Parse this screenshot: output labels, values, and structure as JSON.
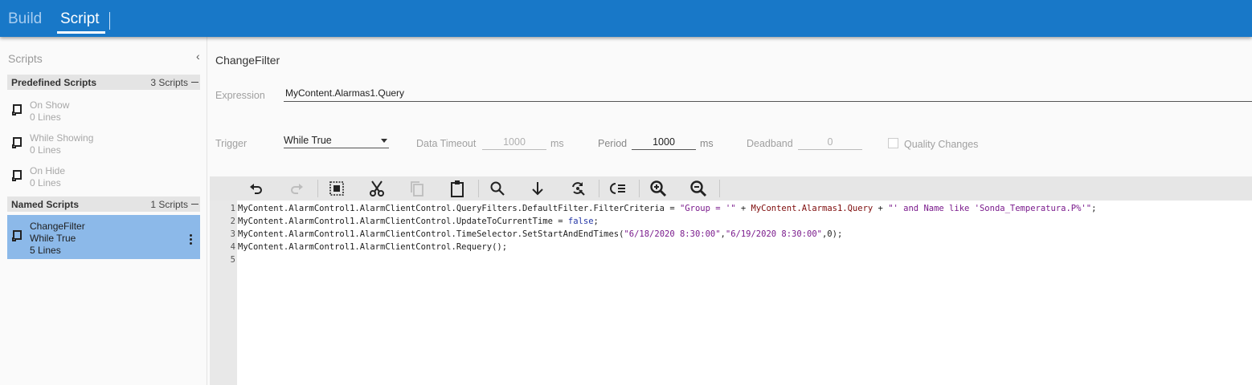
{
  "header": {
    "tabs": [
      {
        "label": "Build"
      },
      {
        "label": "Script"
      }
    ],
    "active_tab": "Script",
    "colors": {
      "bar": "#1878c8",
      "active_text": "#ffffff",
      "inactive_text": "#a8cdf0"
    }
  },
  "sidebar": {
    "title": "Scripts",
    "collapse_icon": "chevron-left-icon",
    "groups": [
      {
        "name": "Predefined Scripts",
        "count": "3 Scripts",
        "items": [
          {
            "name": "On Show",
            "lines": "0 Lines"
          },
          {
            "name": "While Showing",
            "lines": "0 Lines"
          },
          {
            "name": "On Hide",
            "lines": "0 Lines"
          }
        ]
      },
      {
        "name": "Named Scripts",
        "count": "1 Scripts",
        "items": [
          {
            "name": "ChangeFilter",
            "trigger": "While True",
            "lines": "5 Lines",
            "selected": true
          }
        ]
      }
    ],
    "selected_color": "#8cb9e9"
  },
  "main": {
    "title": "ChangeFilter",
    "expression": {
      "label": "Expression",
      "value": "MyContent.Alarmas1.Query"
    },
    "trigger": {
      "label": "Trigger",
      "value": "While True"
    },
    "data_timeout": {
      "label": "Data Timeout",
      "value": "1000",
      "unit": "ms"
    },
    "period": {
      "label": "Period",
      "value": "1000",
      "unit": "ms"
    },
    "deadband": {
      "label": "Deadband",
      "value": "0"
    },
    "quality_changes": {
      "label": "Quality Changes",
      "checked": false
    }
  },
  "toolbar": {
    "buttons": [
      {
        "icon": "undo-icon"
      },
      {
        "icon": "redo-icon",
        "disabled": true
      },
      {
        "icon": "select-all-icon"
      },
      {
        "icon": "cut-icon"
      },
      {
        "icon": "copy-icon",
        "disabled": true
      },
      {
        "icon": "paste-icon"
      },
      {
        "icon": "search-icon"
      },
      {
        "icon": "find-next-icon"
      },
      {
        "icon": "replace-icon"
      },
      {
        "icon": "outdent-icon"
      },
      {
        "icon": "zoom-in-icon"
      },
      {
        "icon": "zoom-out-icon"
      }
    ]
  },
  "editor": {
    "line_numbers": [
      "1",
      "2",
      "3",
      "4",
      "5"
    ],
    "lines": [
      {
        "l1_a": "MyContent.AlarmControl1.AlarmClientControl.QueryFilters.DefaultFilter.FilterCriteria = ",
        "l1_b": "\"Group = '\"",
        "l1_c": " + ",
        "l1_d": "MyContent.Alarmas1.Query",
        "l1_e": " + ",
        "l1_f": "\"' and Name like 'Sonda_Temperatura.P%'\"",
        "l1_g": ";"
      }
    ],
    "line2_a": "MyContent.AlarmControl1.AlarmClientControl.UpdateToCurrentTime = ",
    "line2_b": "false",
    "line2_c": ";",
    "line3_a": "MyContent.AlarmControl1.AlarmClientControl.TimeSelector.SetStartAndEndTimes(",
    "line3_b": "\"6/18/2020 8:30:00\"",
    "line3_c": ",",
    "line3_d": "\"6/19/2020 8:30:00\"",
    "line3_e": ",0);",
    "line4": "MyContent.AlarmControl1.AlarmClientControl.Requery();",
    "colors": {
      "string": "#7a1a8c",
      "reference": "#7d0a0a",
      "keyword": "#2436a6"
    }
  }
}
